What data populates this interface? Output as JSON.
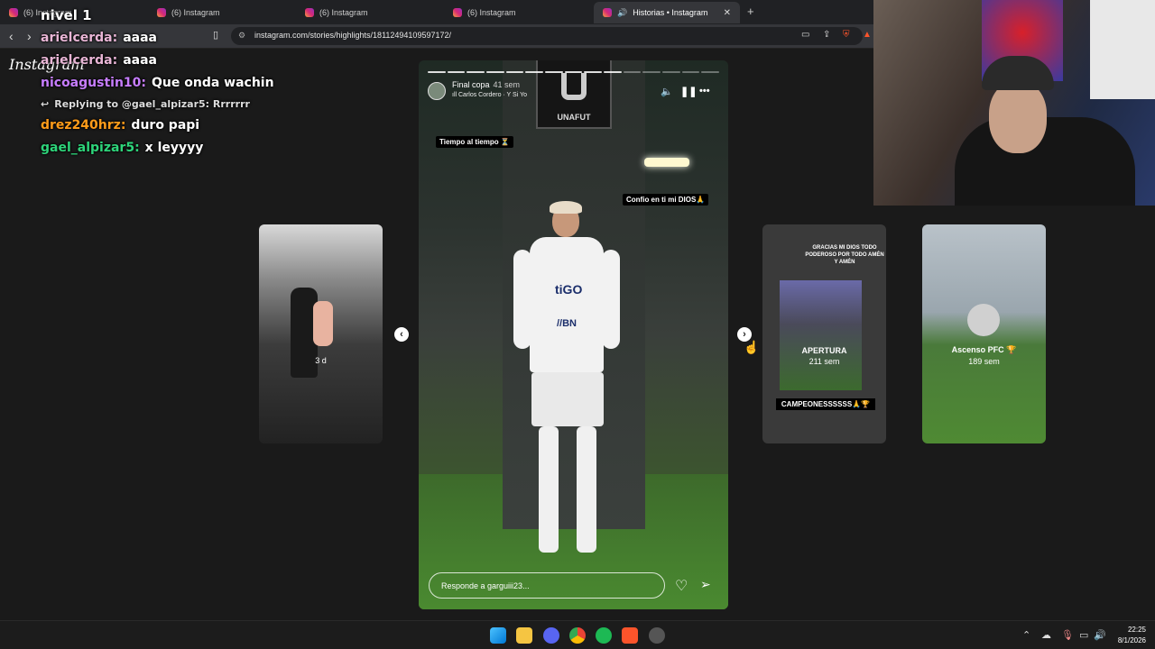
{
  "browser": {
    "tabs": [
      {
        "label": "(6) Instagram"
      },
      {
        "label": "(6) Instagram"
      },
      {
        "label": "(6) Instagram"
      },
      {
        "label": "(6) Instagram"
      },
      {
        "label": "Historias • Instagram"
      }
    ],
    "url": "instagram.com/stories/highlights/18112494109597172/"
  },
  "overlay": {
    "logo": "Instagram",
    "chat_title": "nivel 1",
    "messages": [
      {
        "user": "arielcerda:",
        "text": "aaaa",
        "color": "#e9b6d6"
      },
      {
        "user": "arielcerda:",
        "text": "aaaa",
        "color": "#e9b6d6"
      },
      {
        "user": "nicoagustin10:",
        "text": "Que onda wachin",
        "color": "#c77dff"
      },
      {
        "user": "drez240hrz:",
        "text": "duro papi",
        "color": "#ff9c1a"
      },
      {
        "user": "gael_alpizar5:",
        "text": "x leyyyy",
        "color": "#2ed47a"
      }
    ],
    "reply_text": "Replying to @gael_alpizar5: Rrrrrrr"
  },
  "story": {
    "title": "Final copa",
    "time": "41 sem",
    "song": "Carlos Cordero · Y Si Yo",
    "stickers": {
      "s1": "Tiempo al tiempo ⏳",
      "s2": "Confio en ti mi DIOS🙏"
    },
    "reply_placeholder": "Responde a garguiii23..."
  },
  "thumbs": {
    "left": {
      "time": "3 d"
    },
    "right1": {
      "caption": "GRACIAS MI DIOS TODO PODEROSO POR TODO AMÉN Y AMÉN",
      "label": "APERTURA",
      "time": "211 sem",
      "bottom": "CAMPEONESSSSSS🙏🏆"
    },
    "right2": {
      "label": "Ascenso PFC 🏆",
      "time": "189 sem"
    }
  },
  "taskbar": {
    "time": "22:25",
    "date": "8/1/2026"
  }
}
